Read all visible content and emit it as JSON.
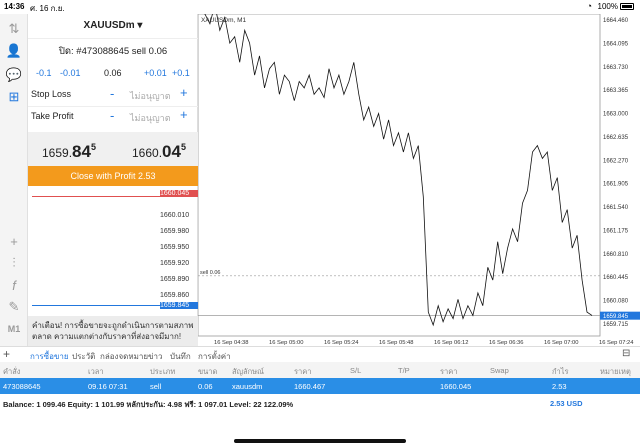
{
  "status": {
    "time": "14:36",
    "date": "ศ. 16 ก.ย.",
    "battery": "100%"
  },
  "panel": {
    "symbol": "XAUUSDm ▾",
    "position": "ปิด: #473088645 sell 0.06",
    "adjust": {
      "m2": "-0.1",
      "m1": "-0.01",
      "value": "0.06",
      "p1": "+0.01",
      "p2": "+0.1"
    },
    "stop_loss": {
      "label": "Stop Loss",
      "minus": "-",
      "placeholder": "ไม่อนุญาต",
      "plus": "+"
    },
    "take_profit": {
      "label": "Take Profit",
      "minus": "-",
      "placeholder": "ไม่อนุญาต",
      "plus": "+"
    },
    "bid": {
      "main": "1659.",
      "big": "84",
      "sup": "5"
    },
    "ask": {
      "main": "1660.",
      "big": "04",
      "sup": "5"
    },
    "close_label": "Close with Profit 2.53",
    "depth_levels": [
      "1660.045",
      "1660.010",
      "1659.980",
      "1659.950",
      "1659.920",
      "1659.890",
      "1659.860",
      "1659.845"
    ],
    "warning": "คำเตือน! การซื้อขายจะถูกดำเนินการตามสภาพตลาด ความแตกต่างกับราคาที่ส่งอาจมีมาก!"
  },
  "chart_data": {
    "type": "line",
    "title": "XAUUSDm, M1",
    "x": [
      "16 Sep 04:38",
      "16 Sep 05:00",
      "16 Sep 05:24",
      "16 Sep 05:48",
      "16 Sep 06:12",
      "16 Sep 06:36",
      "16 Sep 07:00",
      "16 Sep 07:24"
    ],
    "ylim": [
      1659.715,
      1664.46
    ],
    "y_ticks": [
      "1664.460",
      "1664.095",
      "1663.730",
      "1663.365",
      "1663.000",
      "1662.635",
      "1662.270",
      "1661.905",
      "1661.540",
      "1661.175",
      "1660.810",
      "1660.445",
      "1660.080",
      "1659.845",
      "1659.715"
    ],
    "level_label": "sell 0.06",
    "values": [
      1664.6,
      1664.55,
      1664.4,
      1664.7,
      1664.3,
      1664.5,
      1664.1,
      1664.2,
      1663.8,
      1664.3,
      1664.1,
      1663.6,
      1663.9,
      1663.4,
      1663.7,
      1663.8,
      1663.3,
      1663.6,
      1663.5,
      1663.2,
      1663.5,
      1663.4,
      1663.6,
      1663.3,
      1663.4,
      1663.25,
      1663.7,
      1663.4,
      1663.6,
      1663.3,
      1663.5,
      1663.8,
      1663.3,
      1662.9,
      1663.1,
      1662.8,
      1663.0,
      1662.6,
      1662.9,
      1662.5,
      1662.7,
      1662.4,
      1662.7,
      1662.3,
      1662.5,
      1661.7,
      1659.9,
      1659.7,
      1660.0,
      1659.75,
      1659.95,
      1659.8,
      1660.1,
      1659.8,
      1660.0,
      1659.85,
      1660.2,
      1660.0,
      1660.6,
      1660.4,
      1661.0,
      1660.5,
      1660.9,
      1661.2,
      1661.0,
      1661.6,
      1661.8,
      1662.4,
      1662.5,
      1662.3,
      1662.4,
      1661.8,
      1662.0,
      1661.3,
      1661.5,
      1660.9,
      1661.1,
      1660.4,
      1659.9,
      1659.85
    ],
    "bid_line": 1659.845,
    "sell_line": 1660.467,
    "ask_line": 1660.045
  },
  "tabs": [
    "การซื้อขาย",
    "ประวัติ",
    "กล่องจดหมาย",
    "ข่าว",
    "บันทึก",
    "การตั้งค่า"
  ],
  "table": {
    "headers": [
      "คำสั่ง",
      "เวลา",
      "ประเภท",
      "ขนาด",
      "สัญลักษณ์",
      "ราคา",
      "S/L",
      "T/P",
      "ราคา",
      "Swap",
      "กำไร",
      "หมายเหตุ"
    ],
    "row": [
      "473088645",
      "09.16 07:31",
      "sell",
      "0.06",
      "xauusdm",
      "1660.467",
      "",
      "",
      "1660.045",
      "",
      "2.53",
      ""
    ]
  },
  "balance": {
    "text": "Balance: 1 099.46 Equity: 1 101.99 หลักประกัน: 4.98 ฟรี: 1 097.01 Level: 22 122.09%",
    "profit": "2.53  USD"
  }
}
